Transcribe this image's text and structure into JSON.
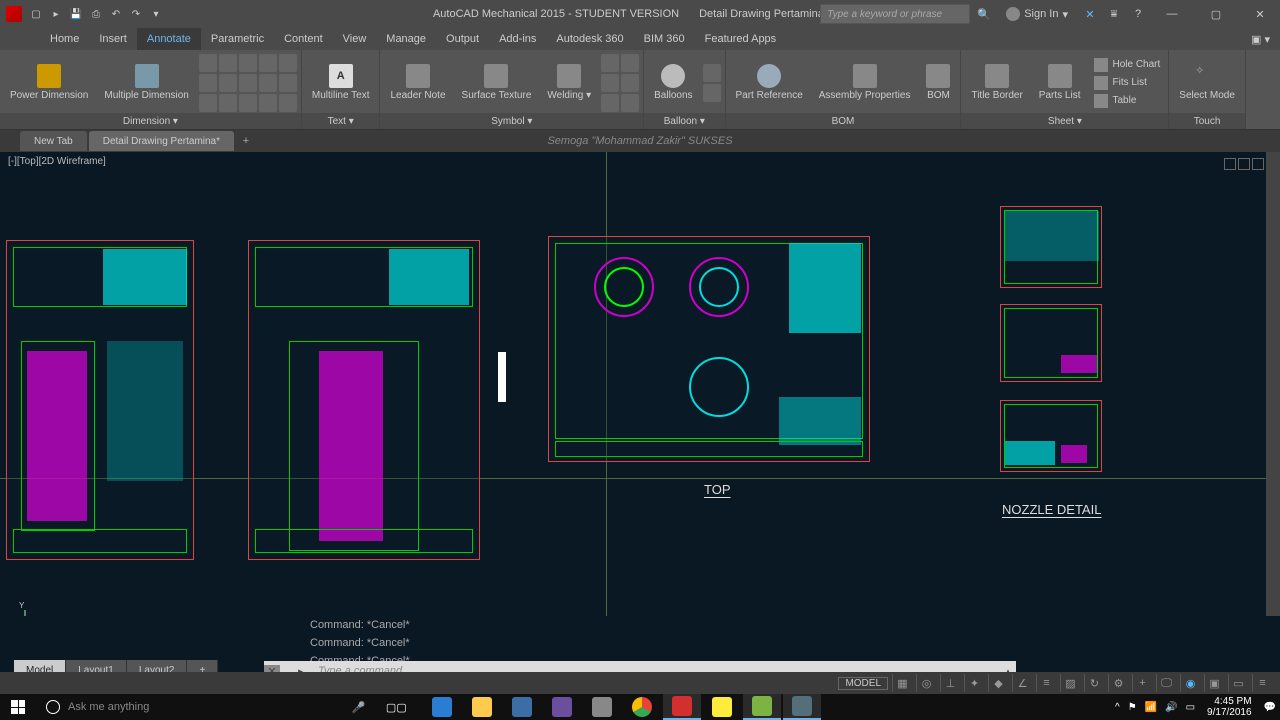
{
  "title": {
    "app": "AutoCAD Mechanical 2015 - STUDENT VERSION",
    "file": "Detail Drawing Pertamina.dwg"
  },
  "search": {
    "placeholder": "Type a keyword or phrase"
  },
  "signin": {
    "label": "Sign In"
  },
  "ribbon_tabs": [
    "Home",
    "Insert",
    "Annotate",
    "Parametric",
    "Content",
    "View",
    "Manage",
    "Output",
    "Add-ins",
    "Autodesk 360",
    "BIM 360",
    "Featured Apps"
  ],
  "active_ribbon_tab": 2,
  "panels": {
    "dimension": {
      "title": "Dimension ▾",
      "power": "Power\nDimension",
      "multiple": "Multiple\nDimension"
    },
    "text": {
      "title": "Text ▾",
      "multiline": "Multiline\nText"
    },
    "symbol": {
      "title": "Symbol ▾",
      "leader": "Leader\nNote",
      "surface": "Surface\nTexture",
      "welding": "Welding ▾"
    },
    "balloon": {
      "title": "Balloon ▾",
      "balloons": "Balloons"
    },
    "bom": {
      "title": "BOM",
      "part": "Part\nReference",
      "assembly": "Assembly\nProperties",
      "bom": "BOM"
    },
    "sheet": {
      "title": "Sheet ▾",
      "titleborder": "Title\nBorder",
      "partslist": "Parts\nList",
      "holechart": "Hole Chart",
      "fitslist": "Fits List",
      "table": "Table"
    },
    "touch": {
      "title": "Touch",
      "select": "Select\nMode"
    }
  },
  "doc_tabs": {
    "new": "New Tab",
    "current": "Detail Drawing Pertamina*",
    "center": "Semoga \"Mohammad Zakir\" SUKSES"
  },
  "viewport": "[-][Top][2D Wireframe]",
  "drawing_labels": {
    "top": "TOP",
    "nozzle": "NOZZLE DETAIL"
  },
  "cmd_history": [
    "Command: *Cancel*",
    "Command: *Cancel*",
    "Command: *Cancel*"
  ],
  "cmd_placeholder": "Type a command",
  "layout_tabs": [
    "Model",
    "Layout1",
    "Layout2"
  ],
  "status": {
    "model": "MODEL"
  },
  "taskbar": {
    "cortana": "Ask me anything",
    "time": "4:45 PM",
    "date": "9/17/2016"
  }
}
